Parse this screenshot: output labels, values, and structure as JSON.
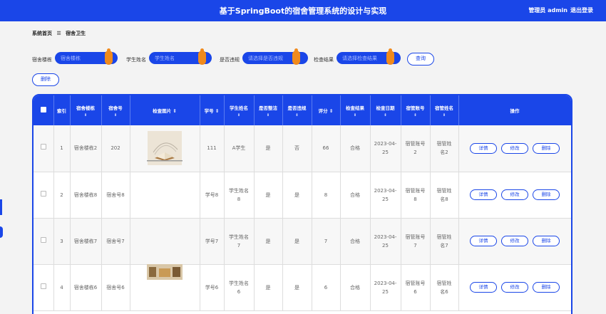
{
  "header": {
    "title": "基于SpringBoot的宿舍管理系统的设计与实现",
    "user": "管理员 admin",
    "logout": "退出登录"
  },
  "breadcrumb": {
    "home": "系统首页",
    "sep": "☰",
    "current": "宿舍卫生"
  },
  "filters": [
    {
      "label": "宿舍楼栋",
      "placeholder": "宿舍楼栋"
    },
    {
      "label": "学生姓名",
      "placeholder": "学生姓名"
    },
    {
      "label": "是否违规",
      "placeholder": "请选择是否违规"
    },
    {
      "label": "检查结果",
      "placeholder": "请选择检查结果"
    }
  ],
  "buttons": {
    "query": "查询",
    "delete": "删除"
  },
  "columns": [
    "索引",
    "宿舍楼栋",
    "宿舍号",
    "检查图片",
    "学号",
    "学生姓名",
    "是否整洁",
    "是否违规",
    "评分",
    "检查结果",
    "检查日期",
    "宿管账号",
    "宿管姓名",
    "操作"
  ],
  "sort_icon": "⇕",
  "row_actions": {
    "detail": "详情",
    "edit": "修改",
    "delete": "删除"
  },
  "rows": [
    {
      "index": "1",
      "building": "宿舍楼栋2",
      "room": "202",
      "image": "book",
      "student_no": "111",
      "student_name": "A学生",
      "tidy": "是",
      "violation": "否",
      "score": "66",
      "result": "合格",
      "date": "2023-04-25",
      "mgr_account": "宿管账号2",
      "mgr_name": "宿管姓名2"
    },
    {
      "index": "2",
      "building": "宿舍楼栋8",
      "room": "宿舍号8",
      "image": "line",
      "student_no": "学号8",
      "student_name": "学生姓名8",
      "tidy": "是",
      "violation": "是",
      "score": "8",
      "result": "合格",
      "date": "2023-04-25",
      "mgr_account": "宿管账号8",
      "mgr_name": "宿管姓名8"
    },
    {
      "index": "3",
      "building": "宿舍楼栋7",
      "room": "宿舍号7",
      "image": "none",
      "student_no": "学号7",
      "student_name": "学生姓名7",
      "tidy": "是",
      "violation": "是",
      "score": "7",
      "result": "合格",
      "date": "2023-04-25",
      "mgr_account": "宿管账号7",
      "mgr_name": "宿管姓名7"
    },
    {
      "index": "4",
      "building": "宿舍楼栋6",
      "room": "宿舍号6",
      "image": "room",
      "student_no": "学号6",
      "student_name": "学生姓名6",
      "tidy": "是",
      "violation": "是",
      "score": "6",
      "result": "合格",
      "date": "2023-04-25",
      "mgr_account": "宿管账号6",
      "mgr_name": "宿管姓名6"
    }
  ]
}
